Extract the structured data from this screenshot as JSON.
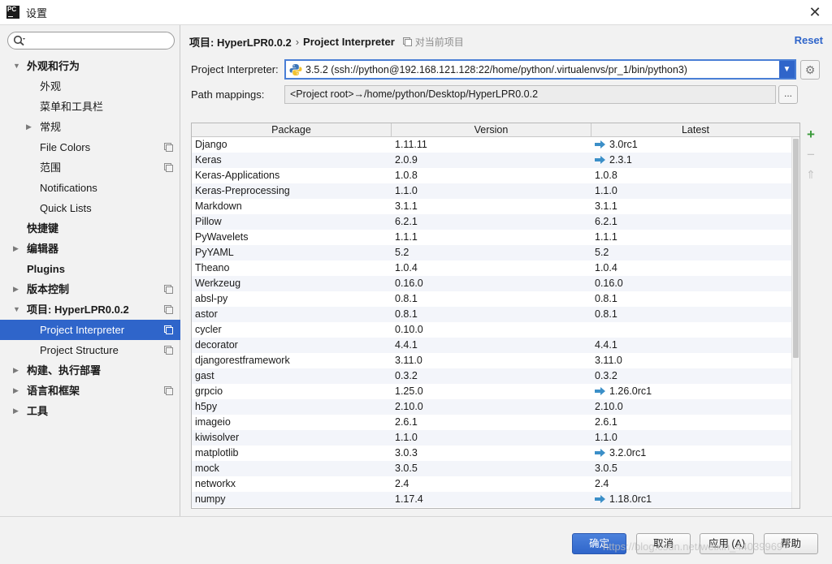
{
  "window": {
    "title": "设置",
    "app_icon": "PC",
    "close_icon": "close-icon"
  },
  "sidebar": {
    "search_placeholder": "",
    "items": [
      {
        "label": "外观和行为",
        "level": 0,
        "arrow": "▼",
        "bold": true,
        "has_proj_icon": false
      },
      {
        "label": "外观",
        "level": 1,
        "arrow": "",
        "bold": false,
        "has_proj_icon": false
      },
      {
        "label": "菜单和工具栏",
        "level": 1,
        "arrow": "",
        "bold": false,
        "has_proj_icon": false
      },
      {
        "label": "常规",
        "level": 1,
        "arrow": "▶",
        "bold": false,
        "has_proj_icon": false
      },
      {
        "label": "File Colors",
        "level": 1,
        "arrow": "",
        "bold": false,
        "has_proj_icon": true
      },
      {
        "label": "范围",
        "level": 1,
        "arrow": "",
        "bold": false,
        "has_proj_icon": true
      },
      {
        "label": "Notifications",
        "level": 1,
        "arrow": "",
        "bold": false,
        "has_proj_icon": false
      },
      {
        "label": "Quick Lists",
        "level": 1,
        "arrow": "",
        "bold": false,
        "has_proj_icon": false
      },
      {
        "label": "快捷键",
        "level": 0,
        "arrow": "",
        "bold": true,
        "has_proj_icon": false
      },
      {
        "label": "编辑器",
        "level": 0,
        "arrow": "▶",
        "bold": true,
        "has_proj_icon": false
      },
      {
        "label": "Plugins",
        "level": 0,
        "arrow": "",
        "bold": true,
        "has_proj_icon": false
      },
      {
        "label": "版本控制",
        "level": 0,
        "arrow": "▶",
        "bold": true,
        "has_proj_icon": true
      },
      {
        "label": "项目: HyperLPR0.0.2",
        "level": 0,
        "arrow": "▼",
        "bold": true,
        "has_proj_icon": true
      },
      {
        "label": "Project Interpreter",
        "level": 1,
        "arrow": "",
        "bold": false,
        "has_proj_icon": true,
        "selected": true
      },
      {
        "label": "Project Structure",
        "level": 1,
        "arrow": "",
        "bold": false,
        "has_proj_icon": true
      },
      {
        "label": "构建、执行部署",
        "level": 0,
        "arrow": "▶",
        "bold": true,
        "has_proj_icon": false
      },
      {
        "label": "语言和框架",
        "level": 0,
        "arrow": "▶",
        "bold": true,
        "has_proj_icon": true
      },
      {
        "label": "工具",
        "level": 0,
        "arrow": "▶",
        "bold": true,
        "has_proj_icon": false
      }
    ]
  },
  "header": {
    "project": "项目: HyperLPR0.0.2",
    "separator": "›",
    "page": "Project Interpreter",
    "current_project_note": "对当前项目",
    "reset": "Reset"
  },
  "interpreter": {
    "label": "Project Interpreter:",
    "value": "3.5.2 (ssh://python@192.168.121.128:22/home/python/.virtualenvs/pr_1/bin/python3)",
    "path_label": "Path mappings:",
    "path_value": "<Project root>→/home/python/Desktop/HyperLPR0.0.2",
    "browse_label": "..."
  },
  "table": {
    "columns": [
      "Package",
      "Version",
      "Latest"
    ],
    "rows": [
      {
        "package": "Django",
        "version": "1.11.11",
        "latest": "3.0rc1",
        "upgrade": true
      },
      {
        "package": "Keras",
        "version": "2.0.9",
        "latest": "2.3.1",
        "upgrade": true
      },
      {
        "package": "Keras-Applications",
        "version": "1.0.8",
        "latest": "1.0.8",
        "upgrade": false
      },
      {
        "package": "Keras-Preprocessing",
        "version": "1.1.0",
        "latest": "1.1.0",
        "upgrade": false
      },
      {
        "package": "Markdown",
        "version": "3.1.1",
        "latest": "3.1.1",
        "upgrade": false
      },
      {
        "package": "Pillow",
        "version": "6.2.1",
        "latest": "6.2.1",
        "upgrade": false
      },
      {
        "package": "PyWavelets",
        "version": "1.1.1",
        "latest": "1.1.1",
        "upgrade": false
      },
      {
        "package": "PyYAML",
        "version": "5.2",
        "latest": "5.2",
        "upgrade": false
      },
      {
        "package": "Theano",
        "version": "1.0.4",
        "latest": "1.0.4",
        "upgrade": false
      },
      {
        "package": "Werkzeug",
        "version": "0.16.0",
        "latest": "0.16.0",
        "upgrade": false
      },
      {
        "package": "absl-py",
        "version": "0.8.1",
        "latest": "0.8.1",
        "upgrade": false
      },
      {
        "package": "astor",
        "version": "0.8.1",
        "latest": "0.8.1",
        "upgrade": false
      },
      {
        "package": "cycler",
        "version": "0.10.0",
        "latest": "",
        "upgrade": false
      },
      {
        "package": "decorator",
        "version": "4.4.1",
        "latest": "4.4.1",
        "upgrade": false
      },
      {
        "package": "djangorestframework",
        "version": "3.11.0",
        "latest": "3.11.0",
        "upgrade": false
      },
      {
        "package": "gast",
        "version": "0.3.2",
        "latest": "0.3.2",
        "upgrade": false
      },
      {
        "package": "grpcio",
        "version": "1.25.0",
        "latest": "1.26.0rc1",
        "upgrade": true
      },
      {
        "package": "h5py",
        "version": "2.10.0",
        "latest": "2.10.0",
        "upgrade": false
      },
      {
        "package": "imageio",
        "version": "2.6.1",
        "latest": "2.6.1",
        "upgrade": false
      },
      {
        "package": "kiwisolver",
        "version": "1.1.0",
        "latest": "1.1.0",
        "upgrade": false
      },
      {
        "package": "matplotlib",
        "version": "3.0.3",
        "latest": "3.2.0rc1",
        "upgrade": true
      },
      {
        "package": "mock",
        "version": "3.0.5",
        "latest": "3.0.5",
        "upgrade": false
      },
      {
        "package": "networkx",
        "version": "2.4",
        "latest": "2.4",
        "upgrade": false
      },
      {
        "package": "numpy",
        "version": "1.17.4",
        "latest": "1.18.0rc1",
        "upgrade": true
      }
    ]
  },
  "tools": {
    "add": "+",
    "remove": "−",
    "upgrade": "⇑"
  },
  "footer": {
    "ok": "确定",
    "cancel": "取消",
    "apply": "应用 (A)",
    "help": "帮助",
    "watermark": "https://blog.csdn.net/weixin_44039969"
  },
  "colors": {
    "accent": "#2f65ca",
    "upgrade_arrow": "#3b8fc8",
    "add_green": "#3a9a3a"
  }
}
